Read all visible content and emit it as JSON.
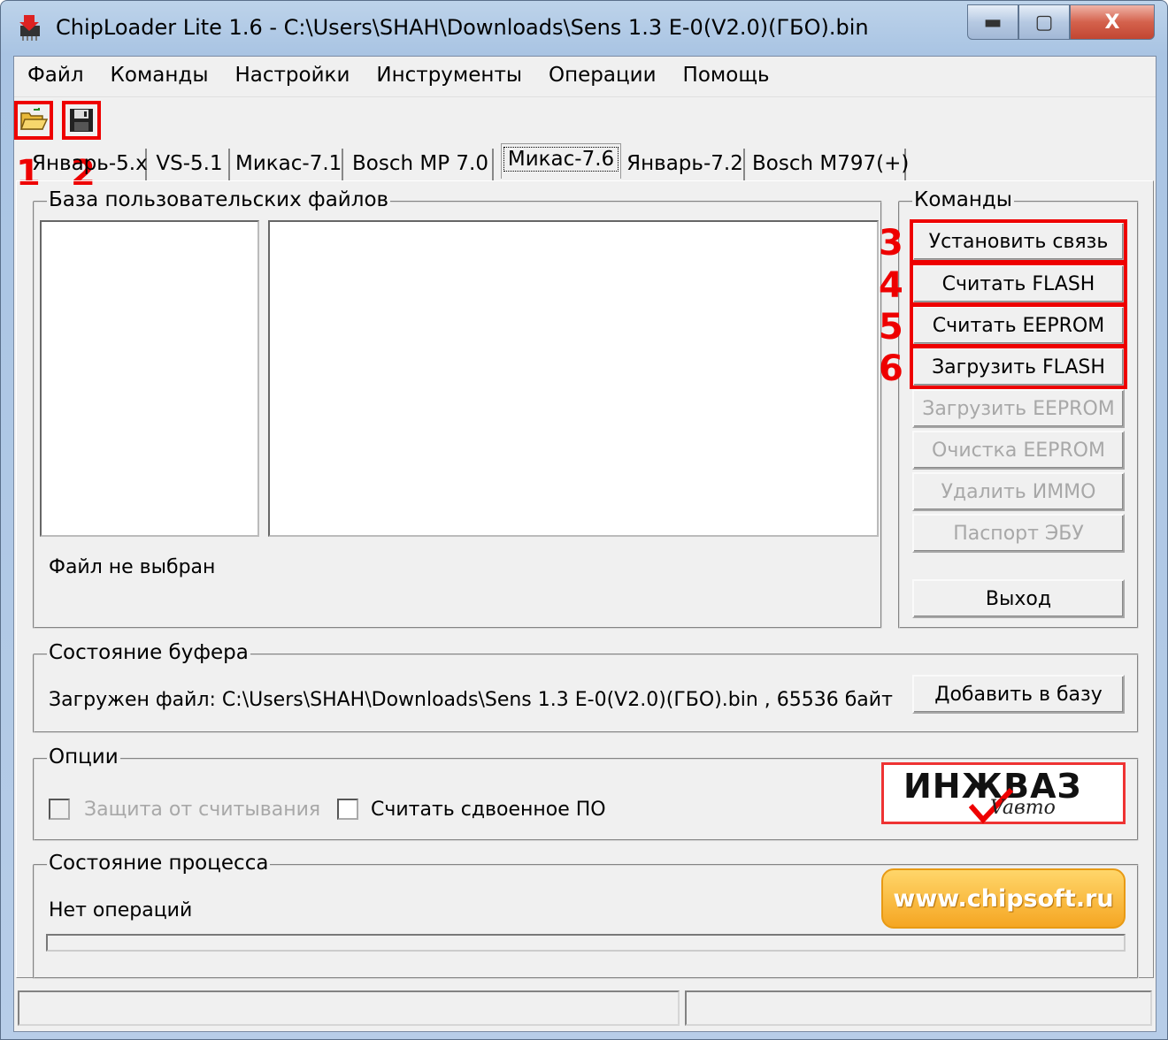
{
  "window": {
    "title": "ChipLoader Lite 1.6 - C:\\Users\\SHAH\\Downloads\\Sens 1.3  E-0(V2.0)(ГБО).bin",
    "min_glyph": "▬",
    "max_glyph": "▢",
    "close_glyph": "X"
  },
  "menu": [
    "Файл",
    "Команды",
    "Настройки",
    "Инструменты",
    "Операции",
    "Помощь"
  ],
  "toolbar": {
    "open_icon": "folder-open-icon",
    "save_icon": "floppy-save-icon",
    "mark1": "1",
    "mark2": "2"
  },
  "tabs": [
    "Январь-5.x",
    "VS-5.1",
    "Микас-7.1",
    "Bosch MP 7.0",
    "Микас-7.6",
    "Январь-7.2",
    "Bosch M797(+)"
  ],
  "active_tab": "Микас-7.6",
  "files_group": {
    "title": "База пользовательских файлов",
    "status": "Файл не выбран"
  },
  "commands_group": {
    "title": "Команды",
    "buttons": [
      {
        "label": "Установить связь",
        "mark": "3"
      },
      {
        "label": "Считать FLASH",
        "mark": "4"
      },
      {
        "label": "Считать EEPROM",
        "mark": "5"
      },
      {
        "label": "Загрузить FLASH",
        "mark": "6"
      },
      {
        "label": "Загрузить EEPROM"
      },
      {
        "label": "Очистка EEPROM"
      },
      {
        "label": "Удалить ИММО"
      },
      {
        "label": "Паспорт ЭБУ"
      }
    ],
    "exit": "Выход"
  },
  "buffer_group": {
    "title": "Состояние буфера",
    "text": "Загружен файл: C:\\Users\\SHAH\\Downloads\\Sens 1.3  E-0(V2.0)(ГБО).bin , 65536 байт",
    "add_button": "Добавить в базу"
  },
  "options_group": {
    "title": "Опции",
    "opt1": "Защита от считывания",
    "opt2": "Считать сдвоенное ПО"
  },
  "logo": {
    "main": "ИНЖВАЗ",
    "sub": "Vaвто"
  },
  "process_group": {
    "title": "Состояние процесса",
    "text": "Нет операций",
    "progress": 0
  },
  "site": "www.chipsoft.ru",
  "colors": {
    "highlight": "#e00000",
    "site_button": "#f5a623"
  }
}
